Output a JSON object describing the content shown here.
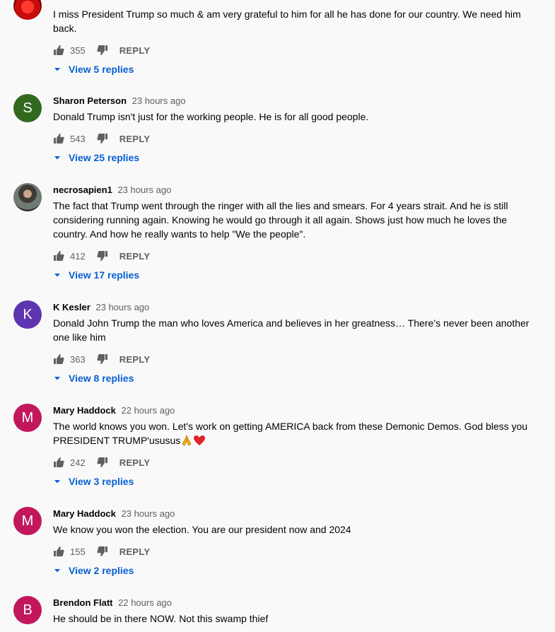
{
  "comments": [
    {
      "avatar_letter": "",
      "author": "",
      "time": "",
      "text": "I miss President Trump so much & am very grateful to him for all he has done for our country. We need him back.",
      "likes": "355",
      "reply_label": "REPLY",
      "replies_label": "View 5 replies"
    },
    {
      "avatar_letter": "S",
      "author": "Sharon Peterson",
      "time": "23 hours ago",
      "text": "Donald Trump isn't just for the working people.  He is for all good people.",
      "likes": "543",
      "reply_label": "REPLY",
      "replies_label": "View 25 replies"
    },
    {
      "avatar_letter": "",
      "author": "necrosapien1",
      "time": "23 hours ago",
      "text": "The fact that Trump went through the ringer with all the lies and smears. For 4 years strait. And he is still considering running again. Knowing he would go through it all again. Shows just how much he loves the country. And how he really wants to help \"We the people\".",
      "likes": "412",
      "reply_label": "REPLY",
      "replies_label": "View 17 replies"
    },
    {
      "avatar_letter": "K",
      "author": "K Kesler",
      "time": "23 hours ago",
      "text": "Donald John Trump the man who loves America and believes in her greatness… There’s never been another one like him",
      "likes": "363",
      "reply_label": "REPLY",
      "replies_label": "View 8 replies"
    },
    {
      "avatar_letter": "M",
      "author": "Mary Haddock",
      "time": "22 hours ago",
      "text": "The world knows you won.  Let's work on getting AMERICA back from these Demonic Demos. God bless you PRESIDENT TRUMP'ususus",
      "likes": "242",
      "reply_label": "REPLY",
      "replies_label": "View 3 replies"
    },
    {
      "avatar_letter": "M",
      "author": "Mary Haddock",
      "time": "23 hours ago",
      "text": "We know you won the election. You are our president now and 2024",
      "likes": "155",
      "reply_label": "REPLY",
      "replies_label": "View 2 replies"
    },
    {
      "avatar_letter": "B",
      "author": "Brendon Flatt",
      "time": "22 hours ago",
      "text": "He should be in there NOW. Not this swamp thief"
    }
  ],
  "icons": {
    "like": "thumb-up-icon",
    "dislike": "thumb-down-icon",
    "expand": "caret-down-icon",
    "pray": "folded-hands-emoji",
    "heart": "red-heart-emoji"
  },
  "colors": {
    "background": "#f9f9f9",
    "link_blue": "#065fd4",
    "secondary_text": "#606060",
    "avatar_green": "#33691e",
    "avatar_purple": "#5e35b1",
    "avatar_pink": "#c2185b"
  }
}
